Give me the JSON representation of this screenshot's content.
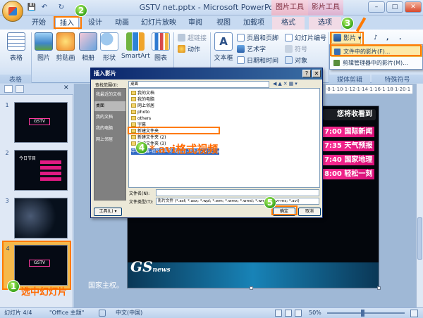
{
  "window": {
    "title": "GSTV net.pptx - Microsoft PowerPoint",
    "context_pic_tools": "图片工具",
    "context_movie_tools": "影片工具",
    "min": "–",
    "max": "□",
    "close": "✕"
  },
  "quick_access": {
    "save": "💾",
    "undo": "↶",
    "redo": "↻"
  },
  "tabs": [
    "开始",
    "插入",
    "设计",
    "动画",
    "幻灯片放映",
    "审阅",
    "视图",
    "加载项",
    "格式",
    "选项"
  ],
  "ribbon": {
    "table": "表格",
    "table_group": "表格",
    "picture": "图片",
    "clipart": "剪贴画",
    "album": "相册",
    "shapes": "形状",
    "smartart": "SmartArt",
    "chart": "图表",
    "hyperlink": "超链接",
    "action": "动作",
    "textbox": "文本框",
    "header_footer": "页眉和页脚",
    "wordart": "艺术字",
    "datetime": "日期和时间",
    "slide_number": "幻灯片编号",
    "symbol": "符号",
    "object": "对象",
    "movie": "影片",
    "sound_label": "♪",
    "media_group": "媒体剪辑",
    "special_group": "特殊符号",
    "sym_comma": ",",
    "sym_period": "."
  },
  "movie_menu": {
    "item1": "文件中的影片(F)...",
    "item2": "剪辑管理器中的影片(M)..."
  },
  "dialog": {
    "title": "插入影片",
    "lookin_label": "查找范围(I):",
    "lookin_value": "桌面",
    "places": [
      "我最近的文档",
      "桌面",
      "我的文档",
      "我的电脑",
      "网上邻居"
    ],
    "files": [
      "我的文档",
      "我的电脑",
      "网上邻居",
      "photo",
      "others",
      "字幕",
      "新建文件夹",
      "新建文件夹 (2)",
      "新建文件夹 (3)"
    ],
    "selected_file": "中-国传媒-我的家声音-高清版-查外网-74123.avi",
    "filename_label": "文件名(N):",
    "filename_value": "",
    "filetype_label": "文件类型(T):",
    "filetype_value": "影片文件 (*.asf; *.asx; *.wpl; *.wm; *.wmx; *.wmd; *.wmz; *.dvr-ms; *.avi)",
    "tools": "工具(L) ▾",
    "ok": "确定",
    "cancel": "取消"
  },
  "annotations": {
    "step1": "1",
    "step2": "2",
    "step3": "3",
    "step4": "4",
    "step5": "5",
    "avi_hint": "*.avi格式视频",
    "select_slide": "选中幻灯片"
  },
  "slides": {
    "nums": [
      "1",
      "2",
      "3",
      "4"
    ],
    "gstv": "GSTV",
    "t2_title": "今日节目"
  },
  "slide_main": {
    "header": "您将收看到",
    "schedule": [
      "7:00 国际新闻",
      "7:35 天气预报",
      "7:40 国家地理",
      "8:00 轻松一刻"
    ],
    "logo": "GS",
    "logo_small": "news",
    "bottom_text": "国家主权。",
    "ruler": "·8·1·10·1·12·1·14·1·16·1·18·1·20·1"
  },
  "status": {
    "slide": "幻灯片 4/4",
    "theme": "\"Office 主题\"",
    "lang": "中文(中国)",
    "zoom": "50%"
  }
}
